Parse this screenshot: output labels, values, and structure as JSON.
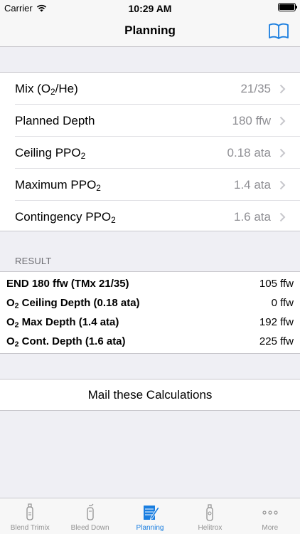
{
  "status": {
    "carrier": "Carrier",
    "time": "10:29 AM"
  },
  "nav": {
    "title": "Planning",
    "book_icon": "book-icon"
  },
  "settings": [
    {
      "name": "mix",
      "label_main": "Mix (O",
      "label_sub": "2",
      "label_tail": "/He)",
      "value": "21/35"
    },
    {
      "name": "planned-depth",
      "label_main": "Planned Depth",
      "label_sub": "",
      "label_tail": "",
      "value": "180 ffw"
    },
    {
      "name": "ceiling-ppo2",
      "label_main": "Ceiling PPO",
      "label_sub": "2",
      "label_tail": "",
      "value": "0.18 ata"
    },
    {
      "name": "maximum-ppo2",
      "label_main": "Maximum PPO",
      "label_sub": "2",
      "label_tail": "",
      "value": "1.4 ata"
    },
    {
      "name": "contingency-ppo2",
      "label_main": "Contingency PPO",
      "label_sub": "2",
      "label_tail": "",
      "value": "1.6 ata"
    }
  ],
  "result": {
    "header": "RESULT",
    "rows": [
      {
        "pre": "",
        "sub": "",
        "label": "END 180 ffw (TMx 21/35)",
        "value": "105 ffw"
      },
      {
        "pre": "O",
        "sub": "2",
        "label": " Ceiling Depth (0.18 ata)",
        "value": "0 ffw"
      },
      {
        "pre": "O",
        "sub": "2",
        "label": " Max Depth (1.4 ata)",
        "value": "192 ffw"
      },
      {
        "pre": "O",
        "sub": "2",
        "label": " Cont. Depth (1.6 ata)",
        "value": "225 ffw"
      }
    ]
  },
  "mail": {
    "label": "Mail these Calculations"
  },
  "tabs": [
    {
      "label": "Blend Trimix",
      "icon": "tank-icon",
      "active": false
    },
    {
      "label": "Bleed Down",
      "icon": "bleed-tank-icon",
      "active": false
    },
    {
      "label": "Planning",
      "icon": "notepad-pencil-icon",
      "active": true
    },
    {
      "label": "Helitrox",
      "icon": "helitrox-tank-icon",
      "active": false
    },
    {
      "label": "More",
      "icon": "more-icon",
      "active": false
    }
  ],
  "colors": {
    "accent": "#1a7ee0",
    "gray_text": "#8e8e93",
    "background": "#efeff4"
  }
}
